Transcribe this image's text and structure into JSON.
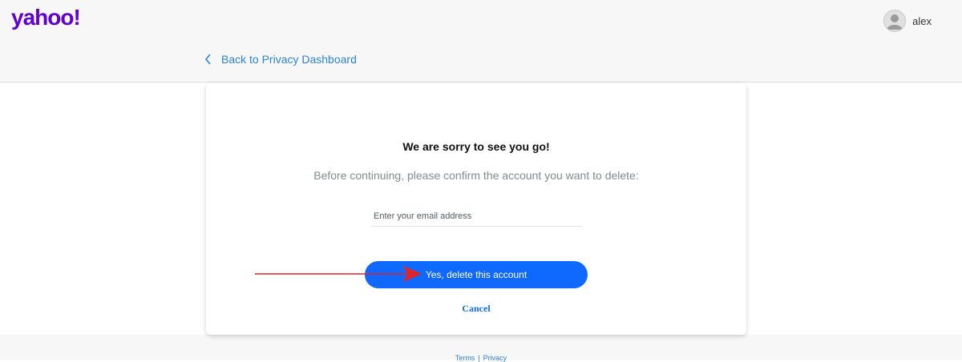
{
  "header": {
    "logo_text": "yahoo!",
    "logo_color": "#6001d2",
    "username": "alex",
    "avatar_icon": "user-avatar-icon"
  },
  "nav": {
    "back_label": "Back to Privacy Dashboard",
    "back_icon": "chevron-left-icon"
  },
  "card": {
    "title": "We are sorry to see you go!",
    "subtitle": "Before continuing, please confirm the account you want to delete:",
    "email_placeholder": "Enter your email address",
    "email_value": "",
    "delete_button": "Yes, delete this account",
    "cancel_label": "Cancel"
  },
  "annotation": {
    "arrow_icon": "red-arrow-icon",
    "arrow_color": "#e0242b"
  },
  "footer": {
    "terms": "Terms",
    "privacy": "Privacy",
    "separator": "|"
  },
  "colors": {
    "accent": "#0f69ff",
    "link": "#2a84d2",
    "brand": "#6001d2"
  }
}
